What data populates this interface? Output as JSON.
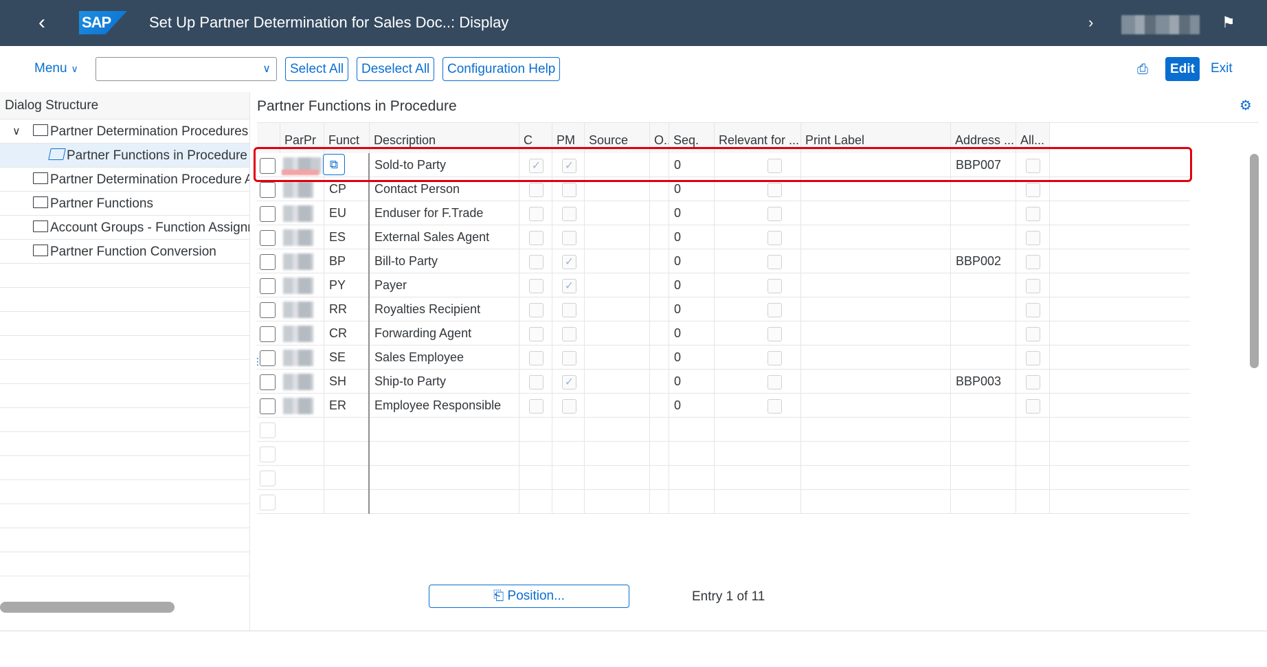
{
  "shell": {
    "logo": "SAP",
    "title": "Set Up Partner Determination for Sales Doc..: Display"
  },
  "toolbar": {
    "menu_label": "Menu",
    "combo_value": "",
    "select_all": "Select All",
    "deselect_all": "Deselect All",
    "config_help": "Configuration Help",
    "edit": "Edit",
    "exit": "Exit"
  },
  "tree": {
    "heading": "Dialog Structure",
    "items": [
      {
        "label": "Partner Determination Procedures"
      },
      {
        "label": "Partner Functions in Procedure"
      },
      {
        "label": "Partner Determination Procedure Assignment"
      },
      {
        "label": "Partner Functions"
      },
      {
        "label": "Account Groups - Function Assignment"
      },
      {
        "label": "Partner Function Conversion"
      }
    ]
  },
  "table": {
    "title": "Partner Functions in Procedure",
    "columns": [
      "ParPr",
      "Funct",
      "Description",
      "C",
      "PM",
      "Source",
      "O..",
      "Seq.",
      "Relevant for ...",
      "Print Label",
      "Address ...",
      "All..."
    ],
    "rows": [
      {
        "funct": "",
        "description": "Sold-to Party",
        "c": true,
        "pm": true,
        "seq": "0",
        "address": "BBP007"
      },
      {
        "funct": "CP",
        "description": "Contact Person",
        "c": false,
        "pm": false,
        "seq": "0",
        "address": ""
      },
      {
        "funct": "EU",
        "description": "Enduser for F.Trade",
        "c": false,
        "pm": false,
        "seq": "0",
        "address": ""
      },
      {
        "funct": "ES",
        "description": "External Sales Agent",
        "c": false,
        "pm": false,
        "seq": "0",
        "address": ""
      },
      {
        "funct": "BP",
        "description": "Bill-to Party",
        "c": false,
        "pm": true,
        "seq": "0",
        "address": "BBP002"
      },
      {
        "funct": "PY",
        "description": "Payer",
        "c": false,
        "pm": true,
        "seq": "0",
        "address": ""
      },
      {
        "funct": "RR",
        "description": "Royalties Recipient",
        "c": false,
        "pm": false,
        "seq": "0",
        "address": ""
      },
      {
        "funct": "CR",
        "description": "Forwarding Agent",
        "c": false,
        "pm": false,
        "seq": "0",
        "address": ""
      },
      {
        "funct": "SE",
        "description": "Sales Employee",
        "c": false,
        "pm": false,
        "seq": "0",
        "address": ""
      },
      {
        "funct": "SH",
        "description": "Ship-to Party",
        "c": false,
        "pm": true,
        "seq": "0",
        "address": "BBP003"
      },
      {
        "funct": "ER",
        "description": "Employee Responsible",
        "c": false,
        "pm": false,
        "seq": "0",
        "address": ""
      }
    ]
  },
  "footer": {
    "position_button": "Position...",
    "entry_text": "Entry 1 of 11"
  },
  "colors": {
    "shell": "#354a5f",
    "accent": "#0a6ed1",
    "highlight": "#e0000f"
  }
}
